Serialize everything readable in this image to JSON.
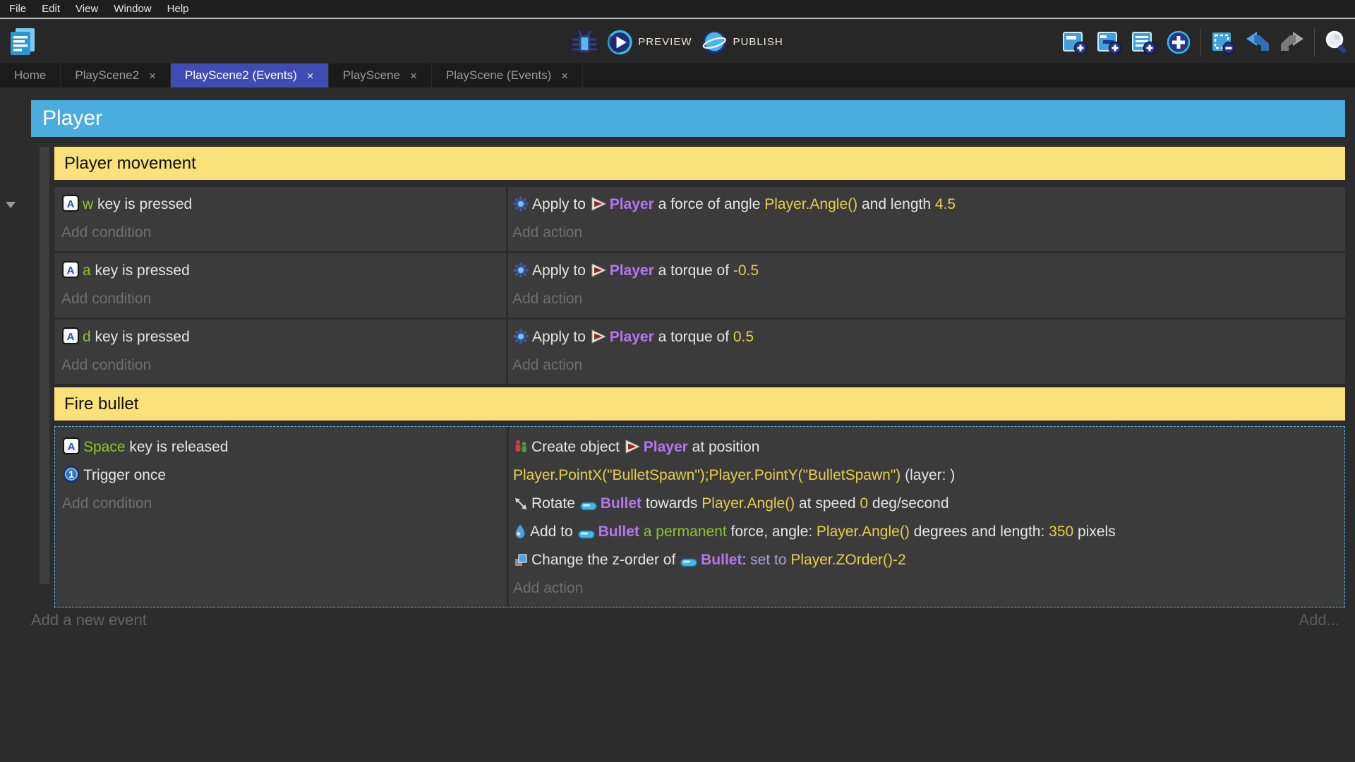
{
  "menu": {
    "items": [
      "File",
      "Edit",
      "View",
      "Window",
      "Help"
    ]
  },
  "toolbar": {
    "preview_label": "PREVIEW",
    "publish_label": "PUBLISH",
    "icons": [
      "debug-icon",
      "preview-icon",
      "publish-icon",
      "add-event-icon",
      "add-subevent-icon",
      "add-comment-icon",
      "add-circle-icon",
      "select-instructions-icon",
      "undo-icon",
      "redo-icon",
      "search-icon"
    ]
  },
  "tabs": [
    {
      "label": "Home",
      "closable": false,
      "active": false
    },
    {
      "label": "PlayScene2",
      "closable": true,
      "active": false
    },
    {
      "label": "PlayScene2 (Events)",
      "closable": true,
      "active": true
    },
    {
      "label": "PlayScene",
      "closable": true,
      "active": false
    },
    {
      "label": "PlayScene (Events)",
      "closable": true,
      "active": false
    }
  ],
  "close_glyph": "×",
  "colors": {
    "accent_blue_header": "#4badde",
    "group_yellow": "#fae17a",
    "active_tab": "#3e4cb4",
    "object_purple": "#b278f0",
    "expression_yellow": "#e5d04a",
    "key_green": "#8fc527",
    "selection_dashed": "#58b9e9"
  },
  "events": {
    "group_title": "Player",
    "subgroup1_title": "Player movement",
    "subgroup2_title": "Fire bullet",
    "add_condition": "Add condition",
    "add_action": "Add action",
    "row1": {
      "condition": [
        {
          "icon": "keyboard-key-icon"
        },
        {
          "t": "w",
          "c": "green"
        },
        {
          "t": " key is pressed"
        }
      ],
      "action": [
        {
          "icon": "physics-icon"
        },
        {
          "t": "Apply to "
        },
        {
          "icon": "player-object-icon"
        },
        {
          "t": "Player",
          "c": "object"
        },
        {
          "t": " a force of angle "
        },
        {
          "t": "Player.Angle()",
          "c": "expr"
        },
        {
          "t": " and length "
        },
        {
          "t": "4.5",
          "c": "expr"
        }
      ]
    },
    "row2": {
      "condition": [
        {
          "icon": "keyboard-key-icon"
        },
        {
          "t": "a",
          "c": "green"
        },
        {
          "t": " key is pressed"
        }
      ],
      "action": [
        {
          "icon": "physics-icon"
        },
        {
          "t": "Apply to "
        },
        {
          "icon": "player-object-icon"
        },
        {
          "t": "Player",
          "c": "object"
        },
        {
          "t": " a torque of "
        },
        {
          "t": "-0.5",
          "c": "expr"
        }
      ]
    },
    "row3": {
      "condition": [
        {
          "icon": "keyboard-key-icon"
        },
        {
          "t": "d",
          "c": "green"
        },
        {
          "t": " key is pressed"
        }
      ],
      "action": [
        {
          "icon": "physics-icon"
        },
        {
          "t": "Apply to "
        },
        {
          "icon": "player-object-icon"
        },
        {
          "t": "Player",
          "c": "object"
        },
        {
          "t": " a torque of "
        },
        {
          "t": "0.5",
          "c": "expr"
        }
      ]
    },
    "fire": {
      "cond_lines": [
        [
          {
            "icon": "keyboard-key-icon"
          },
          {
            "t": "Space",
            "c": "green"
          },
          {
            "t": " key is released"
          }
        ],
        [
          {
            "icon": "trigger-once-icon"
          },
          {
            "t": "Trigger once"
          }
        ]
      ],
      "action_lines": [
        [
          {
            "icon": "create-object-icon"
          },
          {
            "t": "Create object "
          },
          {
            "icon": "player-object-icon"
          },
          {
            "t": "Player",
            "c": "object"
          },
          {
            "t": " at position"
          }
        ],
        [
          {
            "t": "Player.PointX(\"BulletSpawn\");Player.PointY(\"BulletSpawn\")",
            "c": "expr"
          },
          {
            "t": " (layer: )"
          }
        ],
        [
          {
            "icon": "rotate-icon"
          },
          {
            "t": "Rotate "
          },
          {
            "icon": "bullet-object-icon"
          },
          {
            "t": "Bullet",
            "c": "object"
          },
          {
            "t": " towards "
          },
          {
            "t": "Player.Angle()",
            "c": "expr"
          },
          {
            "t": " at speed "
          },
          {
            "t": "0",
            "c": "expr"
          },
          {
            "t": " deg/second"
          }
        ],
        [
          {
            "icon": "force-icon"
          },
          {
            "t": "Add to "
          },
          {
            "icon": "bullet-object-icon"
          },
          {
            "t": "Bullet",
            "c": "object"
          },
          {
            "t": " "
          },
          {
            "t": "a permanent",
            "c": "green"
          },
          {
            "t": " force, angle: "
          },
          {
            "t": "Player.Angle()",
            "c": "expr"
          },
          {
            "t": " degrees and length: "
          },
          {
            "t": "350",
            "c": "expr"
          },
          {
            "t": " pixels"
          }
        ],
        [
          {
            "icon": "zorder-icon"
          },
          {
            "t": "Change the z-order of "
          },
          {
            "icon": "bullet-object-icon"
          },
          {
            "t": "Bullet",
            "c": "object"
          },
          {
            "t": ": "
          },
          {
            "t": "set to ",
            "c": "violet"
          },
          {
            "t": "Player.ZOrder()-2",
            "c": "expr"
          }
        ]
      ]
    }
  },
  "footer": {
    "add_new_event": "Add a new event",
    "add_short": "Add..."
  }
}
